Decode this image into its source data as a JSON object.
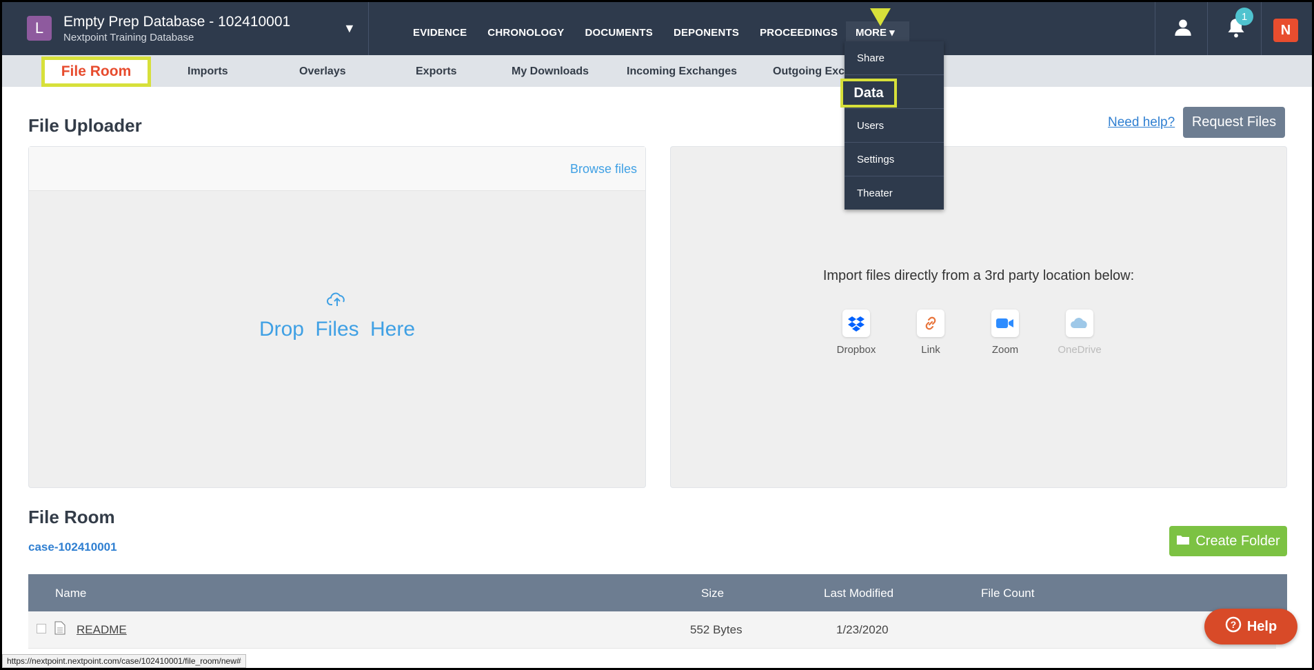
{
  "header": {
    "avatar_letter": "L",
    "db_title": "Empty Prep Database - 102410001",
    "db_subtitle": "Nextpoint Training Database",
    "nav": [
      "EVIDENCE",
      "CHRONOLOGY",
      "DOCUMENTS",
      "DEPONENTS",
      "PROCEEDINGS"
    ],
    "more_label": "MORE ▾",
    "notification_count": "1",
    "brand_letter": "N"
  },
  "subnav": {
    "file_room": "File Room",
    "items": [
      "Imports",
      "Overlays",
      "Exports",
      "My Downloads",
      "Incoming Exchanges",
      "Outgoing Exch"
    ]
  },
  "dropdown": {
    "items": [
      "Share",
      "Data",
      "Users",
      "Settings",
      "Theater"
    ]
  },
  "uploader": {
    "title": "File Uploader",
    "need_help": "Need help?",
    "request_files": "Request Files",
    "browse_files": "Browse files",
    "drop_text": "Drop Files Here",
    "import_text": "Import files directly from a 3rd party location below:",
    "sources": [
      {
        "label": "Dropbox",
        "icon": "dropbox-icon",
        "color": "#0061fe"
      },
      {
        "label": "Link",
        "icon": "link-icon",
        "color": "#e8743b"
      },
      {
        "label": "Zoom",
        "icon": "zoom-icon",
        "color": "#2d8cff"
      },
      {
        "label": "OneDrive",
        "icon": "onedrive-icon",
        "color": "#9ec8e8"
      }
    ]
  },
  "file_room": {
    "title": "File Room",
    "case_link": "case-102410001",
    "create_folder": "Create Folder",
    "columns": [
      "Name",
      "Size",
      "Last Modified",
      "File Count"
    ],
    "rows": [
      {
        "name": "README",
        "size": "552 Bytes",
        "modified": "1/23/2020",
        "count": ""
      }
    ]
  },
  "status_url": "https://nextpoint.nextpoint.com/case/102410001/file_room/new#",
  "help_label": "Help",
  "colors": {
    "nav_bg": "#2e3a4c",
    "highlight": "#d7e03a",
    "accent_red": "#e74c2e",
    "link_blue": "#3fa0e4",
    "green": "#7cc243"
  }
}
